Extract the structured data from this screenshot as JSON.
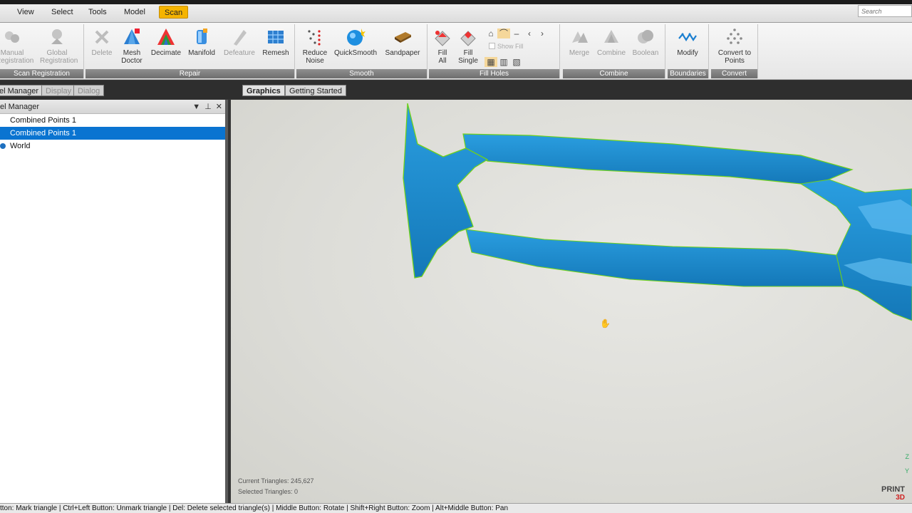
{
  "menu": {
    "items": [
      "View",
      "Select",
      "Tools",
      "Model",
      "Scan"
    ],
    "active": "Scan",
    "search_placeholder": "Search"
  },
  "ribbon": {
    "groups": {
      "scan_registration": {
        "label": "Scan Registration",
        "tools": [
          {
            "label": "Manual\nRegistration",
            "icon": "manual-registration-icon",
            "enabled": false
          },
          {
            "label": "Global\nRegistration",
            "icon": "global-registration-icon",
            "enabled": false
          }
        ]
      },
      "repair": {
        "label": "Repair",
        "tools": [
          {
            "label": "Delete",
            "icon": "delete-icon",
            "enabled": false
          },
          {
            "label": "Mesh\nDoctor",
            "icon": "mesh-doctor-icon",
            "enabled": true
          },
          {
            "label": "Decimate",
            "icon": "decimate-icon",
            "enabled": true
          },
          {
            "label": "Manifold",
            "icon": "manifold-icon",
            "enabled": true
          },
          {
            "label": "Defeature",
            "icon": "defeature-icon",
            "enabled": false
          },
          {
            "label": "Remesh",
            "icon": "remesh-icon",
            "enabled": true
          }
        ]
      },
      "smooth": {
        "label": "Smooth",
        "tools": [
          {
            "label": "Reduce\nNoise",
            "icon": "reduce-noise-icon",
            "enabled": true
          },
          {
            "label": "QuickSmooth",
            "icon": "quicksmooth-icon",
            "enabled": true
          },
          {
            "label": "Sandpaper",
            "icon": "sandpaper-icon",
            "enabled": true
          }
        ]
      },
      "fill_holes": {
        "label": "Fill Holes",
        "tools": [
          {
            "label": "Fill\nAll",
            "icon": "fill-all-icon",
            "enabled": true
          },
          {
            "label": "Fill\nSingle",
            "icon": "fill-single-icon",
            "enabled": true
          }
        ],
        "show_fill": "Show Fill"
      },
      "combine": {
        "label": "Combine",
        "tools": [
          {
            "label": "Merge",
            "icon": "merge-icon",
            "enabled": false
          },
          {
            "label": "Combine",
            "icon": "combine-icon",
            "enabled": false
          },
          {
            "label": "Boolean",
            "icon": "boolean-icon",
            "enabled": false
          }
        ]
      },
      "boundaries": {
        "label": "Boundaries",
        "tools": [
          {
            "label": "Modify",
            "icon": "modify-icon",
            "enabled": true
          }
        ]
      },
      "convert": {
        "label": "Convert",
        "tools": [
          {
            "label": "Convert to\nPoints",
            "icon": "convert-to-points-icon",
            "enabled": true
          }
        ]
      }
    }
  },
  "left_tabs": [
    "el Manager",
    "Display",
    "Dialog"
  ],
  "viewport_tabs": [
    "Graphics",
    "Getting Started"
  ],
  "panel": {
    "title": "el Manager",
    "tree": [
      {
        "label": "Combined Points 1",
        "selected": false
      },
      {
        "label": "Combined Points 1",
        "selected": true
      },
      {
        "label": "World",
        "selected": false
      }
    ]
  },
  "viewport": {
    "current_triangles": "Current Triangles: 245,627",
    "selected_triangles": "Selected Triangles: 0",
    "brand": "PRINT",
    "brand_sub": "3D",
    "axis_y": "Y",
    "axis_z": "Z",
    "mesh_color": "#1d8fd0",
    "edge_color": "#6fd11a"
  },
  "status": {
    "text": "tton: Mark triangle | Ctrl+Left Button: Unmark triangle | Del: Delete selected triangle(s) | Middle Button: Rotate | Shift+Right Button: Zoom | Alt+Middle Button: Pan"
  }
}
